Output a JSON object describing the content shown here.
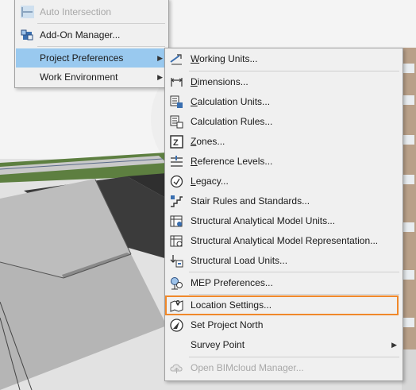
{
  "parent_menu": {
    "items": [
      {
        "label": "Auto Intersection",
        "disabled": true,
        "icon": "auto-intersection-icon"
      },
      {
        "label": "Add-On Manager...",
        "icon": "add-on-manager-icon"
      },
      {
        "label": "Project Preferences",
        "active": true,
        "submenu": true
      },
      {
        "label": "Work Environment",
        "submenu": true
      }
    ]
  },
  "submenu": {
    "items": [
      {
        "label": "Working Units...",
        "underline": "W",
        "rest": "orking Units...",
        "icon": "ruler-icon"
      },
      {
        "label": "Dimensions...",
        "underline": "D",
        "rest": "imensions...",
        "icon": "dimensions-icon"
      },
      {
        "label": "Calculation Units...",
        "underline": "C",
        "rest": "alculation Units...",
        "icon": "calculation-units-icon"
      },
      {
        "label": "Calculation Rules...",
        "underline": "",
        "rest": "Calculation Rules...",
        "icon": "calculation-rules-icon"
      },
      {
        "label": "Zones...",
        "underline": "Z",
        "rest": "ones...",
        "icon": "zones-icon"
      },
      {
        "label": "Reference Levels...",
        "underline": "R",
        "rest": "eference Levels...",
        "icon": "reference-levels-icon"
      },
      {
        "label": "Legacy...",
        "underline": "L",
        "rest": "egacy...",
        "icon": "legacy-icon"
      },
      {
        "label": "Stair Rules and Standards...",
        "underline": "",
        "rest": "Stair Rules and Standards...",
        "icon": "stair-rules-icon"
      },
      {
        "label": "Structural Analytical Model Units...",
        "underline": "",
        "rest": "Structural Analytical Model Units...",
        "icon": "sam-units-icon"
      },
      {
        "label": "Structural Analytical Model Representation...",
        "underline": "",
        "rest": "Structural Analytical Model Representation...",
        "icon": "sam-representation-icon"
      },
      {
        "label": "Structural Load Units...",
        "underline": "",
        "rest": "Structural Load Units...",
        "icon": "structural-load-units-icon"
      },
      {
        "label": "MEP Preferences...",
        "underline": "",
        "rest": "MEP Preferences...",
        "icon": "mep-preferences-icon"
      },
      {
        "label": "Location Settings...",
        "underline": "",
        "rest": "Location Settings...",
        "icon": "location-settings-icon",
        "highlighted": true
      },
      {
        "label": "Set Project North",
        "underline": "",
        "rest": "Set Project North",
        "icon": "project-north-icon"
      },
      {
        "label": "Survey Point",
        "underline": "",
        "rest": "Survey Point",
        "submenu": true
      },
      {
        "label": "Open BIMcloud Manager...",
        "underline": "",
        "rest": "Open BIMcloud Manager...",
        "icon": "bimcloud-icon",
        "disabled": true
      }
    ]
  },
  "colors": {
    "highlight_border": "#f0882a",
    "active_item": "#99c9ef"
  }
}
